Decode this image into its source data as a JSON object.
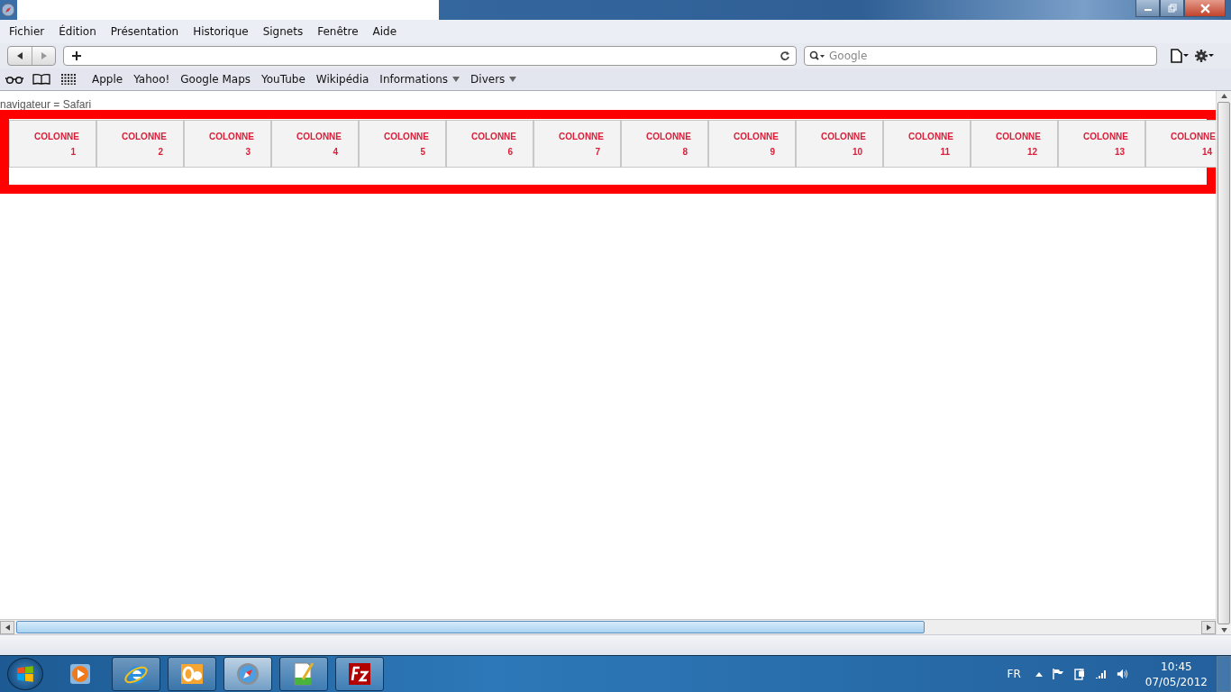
{
  "menu": [
    "Fichier",
    "Édition",
    "Présentation",
    "Historique",
    "Signets",
    "Fenêtre",
    "Aide"
  ],
  "search": {
    "placeholder": "Google"
  },
  "bookmarks": [
    {
      "label": "Apple",
      "menu": false
    },
    {
      "label": "Yahoo!",
      "menu": false
    },
    {
      "label": "Google Maps",
      "menu": false
    },
    {
      "label": "YouTube",
      "menu": false
    },
    {
      "label": "Wikipédia",
      "menu": false
    },
    {
      "label": "Informations",
      "menu": true
    },
    {
      "label": "Divers",
      "menu": true
    }
  ],
  "page_text": "navigateur = Safari",
  "table": {
    "columns": [
      {
        "label": "COLONNE",
        "number": "1"
      },
      {
        "label": "COLONNE",
        "number": "2"
      },
      {
        "label": "COLONNE",
        "number": "3"
      },
      {
        "label": "COLONNE",
        "number": "4"
      },
      {
        "label": "COLONNE",
        "number": "5"
      },
      {
        "label": "COLONNE",
        "number": "6"
      },
      {
        "label": "COLONNE",
        "number": "7"
      },
      {
        "label": "COLONNE",
        "number": "8"
      },
      {
        "label": "COLONNE",
        "number": "9"
      },
      {
        "label": "COLONNE",
        "number": "10"
      },
      {
        "label": "COLONNE",
        "number": "11"
      },
      {
        "label": "COLONNE",
        "number": "12"
      },
      {
        "label": "COLONNE",
        "number": "13"
      },
      {
        "label": "COLONNE",
        "number": "14"
      }
    ]
  },
  "taskbar": {
    "apps": [
      {
        "kind": "media",
        "running": false,
        "selected": false
      },
      {
        "kind": "browser",
        "running": true,
        "selected": false
      },
      {
        "kind": "mail",
        "running": true,
        "selected": false
      },
      {
        "kind": "compass",
        "running": true,
        "selected": true
      },
      {
        "kind": "editor",
        "running": true,
        "selected": false
      },
      {
        "kind": "ftp",
        "running": true,
        "selected": false
      }
    ],
    "language": "FR",
    "time": "10:45",
    "date": "07/05/2012"
  }
}
